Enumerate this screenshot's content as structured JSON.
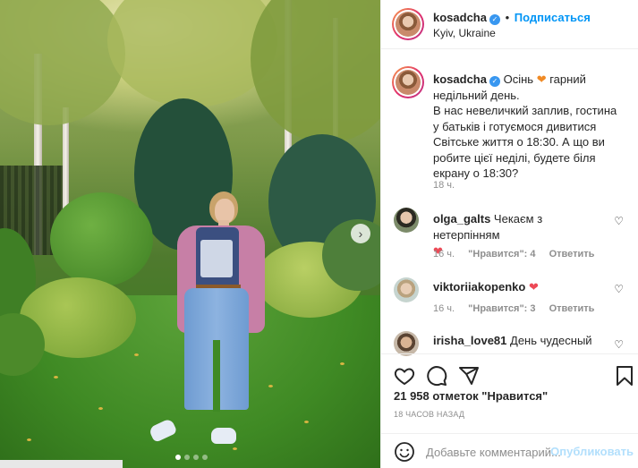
{
  "header": {
    "username": "kosadcha",
    "separator": "•",
    "follow_label": "Подписаться",
    "location": "Kyiv, Ukraine"
  },
  "caption": {
    "username": "kosadcha",
    "text_before_heart": "Осінь",
    "text_after_heart": "гарний недільний день.",
    "body": "В нас невеличкий заплив, гостина у батьків і готуємося дивитися Світське життя о 18:30. А що ви робите цієї неділі, будете біля екрану о 18:30?",
    "time": "18 ч."
  },
  "comments": [
    {
      "username": "olga_galts",
      "text": "Чекаєм з нетерпінням",
      "emoji": "❤",
      "time": "16 ч.",
      "likes_label": "\"Нравится\": 4",
      "reply_label": "Ответить"
    },
    {
      "username": "viktoriiakopenko",
      "text": "",
      "emoji": "❤",
      "time": "16 ч.",
      "likes_label": "\"Нравится\": 3",
      "reply_label": "Ответить"
    },
    {
      "username": "irisha_love81",
      "text": "День чудесный",
      "emoji": "",
      "time": "",
      "likes_label": "",
      "reply_label": ""
    }
  ],
  "likes": "21 958 отметок \"Нравится\"",
  "posted": "18 ЧАСОВ НАЗАД",
  "add_comment": {
    "placeholder": "Добавьте комментарий...",
    "publish_label": "Опубликовать"
  },
  "icons": {
    "like": "heart-outline-icon",
    "comment": "comment-bubble-icon",
    "share": "paper-plane-icon",
    "save": "bookmark-icon",
    "emoji": "smiley-icon",
    "next": "chevron-right-icon"
  },
  "carousel": {
    "slides": 4,
    "active": 0
  },
  "colors": {
    "link": "#0095f6",
    "heart": "#ed4956",
    "verified": "#3897f0",
    "muted": "#8e8e8e"
  }
}
